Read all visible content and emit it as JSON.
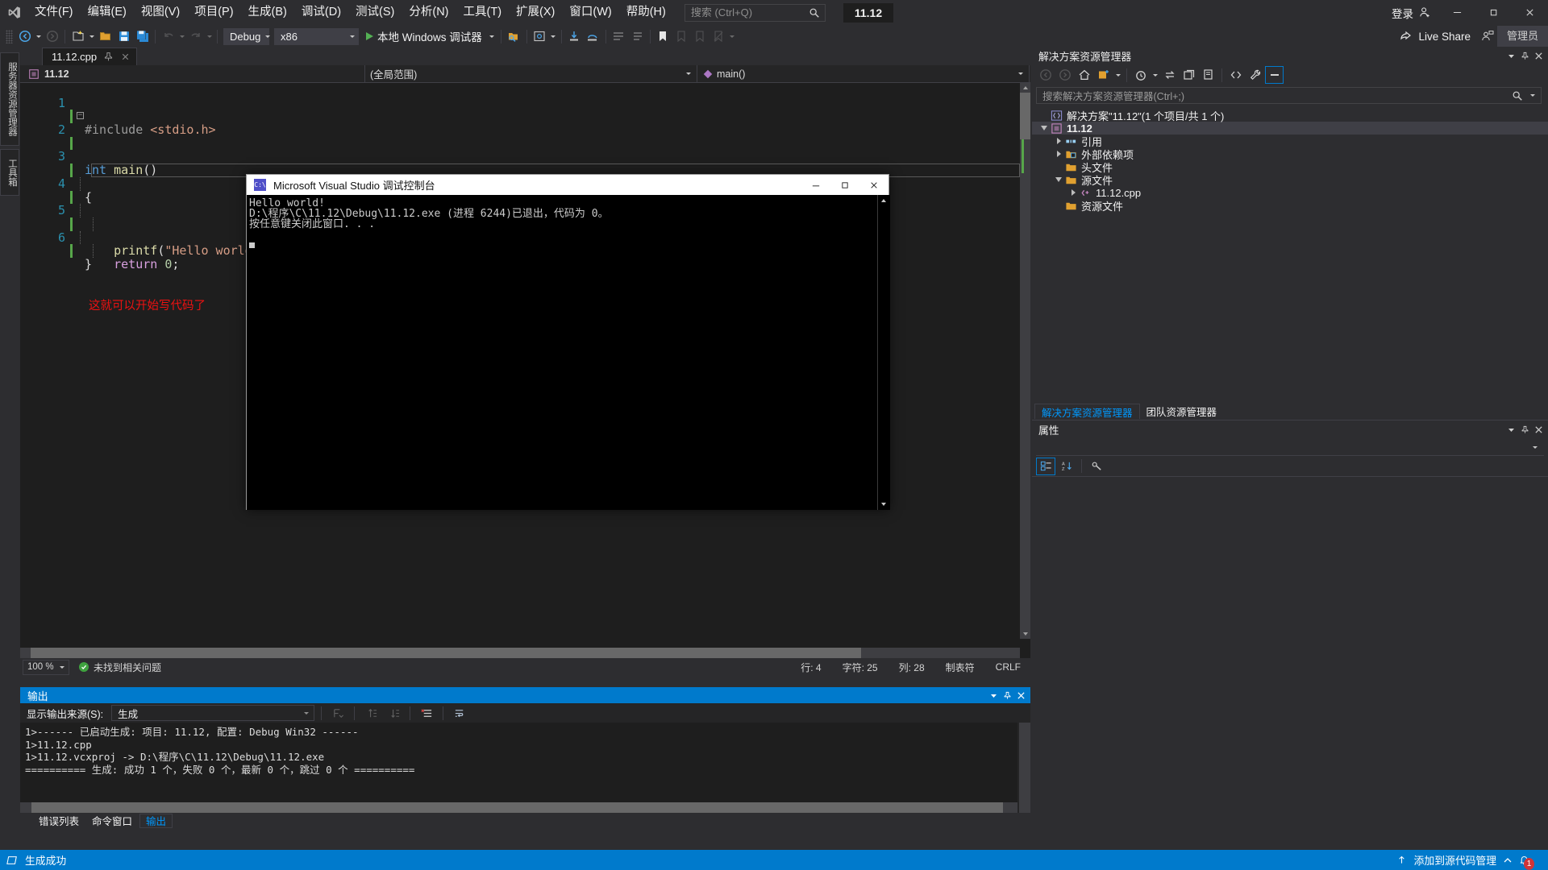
{
  "app": {
    "window_title": "11.12",
    "admin_label": "管理员",
    "signin_label": "登录",
    "live_share_label": "Live Share"
  },
  "menu": {
    "items": [
      {
        "label": "文件(F)",
        "name": "menu-file"
      },
      {
        "label": "编辑(E)",
        "name": "menu-edit"
      },
      {
        "label": "视图(V)",
        "name": "menu-view"
      },
      {
        "label": "项目(P)",
        "name": "menu-project"
      },
      {
        "label": "生成(B)",
        "name": "menu-build"
      },
      {
        "label": "调试(D)",
        "name": "menu-debug"
      },
      {
        "label": "测试(S)",
        "name": "menu-test"
      },
      {
        "label": "分析(N)",
        "name": "menu-analyze"
      },
      {
        "label": "工具(T)",
        "name": "menu-tools"
      },
      {
        "label": "扩展(X)",
        "name": "menu-extensions"
      },
      {
        "label": "窗口(W)",
        "name": "menu-window"
      },
      {
        "label": "帮助(H)",
        "name": "menu-help"
      }
    ],
    "search_placeholder": "搜索 (Ctrl+Q)",
    "search_value": ""
  },
  "toolbar": {
    "configuration": "Debug",
    "platform": "x86",
    "run_label": "本地 Windows 调试器"
  },
  "vertical_tabs": [
    {
      "label": "服务器资源管理器",
      "name": "vtab-server-explorer"
    },
    {
      "label": "工具箱",
      "name": "vtab-toolbox"
    }
  ],
  "editor": {
    "tab_name": "11.12.cpp",
    "navbar": {
      "project": "11.12",
      "scope": "(全局范围)",
      "member": "main()"
    },
    "lines": [
      {
        "n": "1",
        "segments": [
          {
            "t": "#include ",
            "c": "pp"
          },
          {
            "t": "<stdio.h>",
            "c": "hdr"
          }
        ]
      },
      {
        "n": "2",
        "segments": [
          {
            "t": "int",
            "c": "kw"
          },
          {
            "t": " ",
            "c": "txt"
          },
          {
            "t": "main",
            "c": "fn"
          },
          {
            "t": "()",
            "c": "txt"
          }
        ]
      },
      {
        "n": "3",
        "segments": [
          {
            "t": "{",
            "c": "txt"
          }
        ]
      },
      {
        "n": "4",
        "segments": [
          {
            "t": "    ",
            "c": "txt"
          },
          {
            "t": "printf",
            "c": "fn"
          },
          {
            "t": "(",
            "c": "txt"
          },
          {
            "t": "\"Hello world!\"",
            "c": "str"
          },
          {
            "t": ");",
            "c": "txt"
          }
        ]
      },
      {
        "n": "5",
        "segments": [
          {
            "t": "    ",
            "c": "txt"
          },
          {
            "t": "return",
            "c": "ctl"
          },
          {
            "t": " ",
            "c": "txt"
          },
          {
            "t": "0",
            "c": "num"
          },
          {
            "t": ";",
            "c": "txt"
          }
        ]
      },
      {
        "n": "6",
        "segments": [
          {
            "t": "}",
            "c": "txt"
          }
        ]
      }
    ],
    "annotation": "这就可以开始写代码了",
    "status": {
      "zoom": "100 %",
      "issues": "未找到相关问题",
      "line": "行: 4",
      "char": "字符: 25",
      "col": "列: 28",
      "tabs_mode": "制表符",
      "eol": "CRLF"
    }
  },
  "console": {
    "title": "Microsoft Visual Studio 调试控制台",
    "icon_text": "C:\\",
    "lines": [
      "Hello world!",
      "D:\\程序\\C\\11.12\\Debug\\11.12.exe (进程 6244)已退出，代码为 0。",
      "按任意键关闭此窗口. . ."
    ]
  },
  "solution_explorer": {
    "title": "解决方案资源管理器",
    "search_placeholder": "搜索解决方案资源管理器(Ctrl+;)",
    "tree": [
      {
        "label": "解决方案\"11.12\"(1 个项目/共 1 个)",
        "indent": 0,
        "twisty": "none",
        "icon": "solution-icon",
        "selected": false,
        "name": "tree-item-solution"
      },
      {
        "label": "11.12",
        "indent": 1,
        "twisty": "open",
        "icon": "project-icon",
        "selected": true,
        "name": "tree-item-project"
      },
      {
        "label": "引用",
        "indent": 2,
        "twisty": "closed",
        "icon": "references-icon",
        "selected": false,
        "name": "tree-item-references"
      },
      {
        "label": "外部依赖项",
        "indent": 2,
        "twisty": "closed",
        "icon": "ext-dep-icon",
        "selected": false,
        "name": "tree-item-external-dependencies"
      },
      {
        "label": "头文件",
        "indent": 2,
        "twisty": "none",
        "icon": "folder-icon",
        "selected": false,
        "name": "tree-item-header-files"
      },
      {
        "label": "源文件",
        "indent": 2,
        "twisty": "open",
        "icon": "folder-icon",
        "selected": false,
        "name": "tree-item-source-files"
      },
      {
        "label": "11.12.cpp",
        "indent": 3,
        "twisty": "closed",
        "icon": "cpp-file-icon",
        "selected": false,
        "name": "tree-item-cpp-file"
      },
      {
        "label": "资源文件",
        "indent": 2,
        "twisty": "none",
        "icon": "folder-icon",
        "selected": false,
        "name": "tree-item-resource-files"
      }
    ],
    "tabs": [
      {
        "label": "解决方案资源管理器",
        "active": true,
        "name": "tab-solution-explorer"
      },
      {
        "label": "团队资源管理器",
        "active": false,
        "name": "tab-team-explorer"
      }
    ]
  },
  "properties": {
    "title": "属性",
    "selected_object": ""
  },
  "output": {
    "title": "输出",
    "source_label": "显示输出来源(S):",
    "source_value": "生成",
    "lines": [
      "1>------ 已启动生成: 项目: 11.12, 配置: Debug Win32 ------",
      "1>11.12.cpp",
      "1>11.12.vcxproj -> D:\\程序\\C\\11.12\\Debug\\11.12.exe",
      "========== 生成: 成功 1 个，失败 0 个，最新 0 个，跳过 0 个 =========="
    ],
    "tabs": [
      {
        "label": "错误列表",
        "active": false,
        "name": "tab-error-list"
      },
      {
        "label": "命令窗口",
        "active": false,
        "name": "tab-command-window"
      },
      {
        "label": "输出",
        "active": true,
        "name": "tab-output"
      }
    ]
  },
  "statusbar": {
    "build_status": "生成成功",
    "source_control": "添加到源代码管理",
    "notification_count": "1",
    "accent": "#007acc"
  }
}
